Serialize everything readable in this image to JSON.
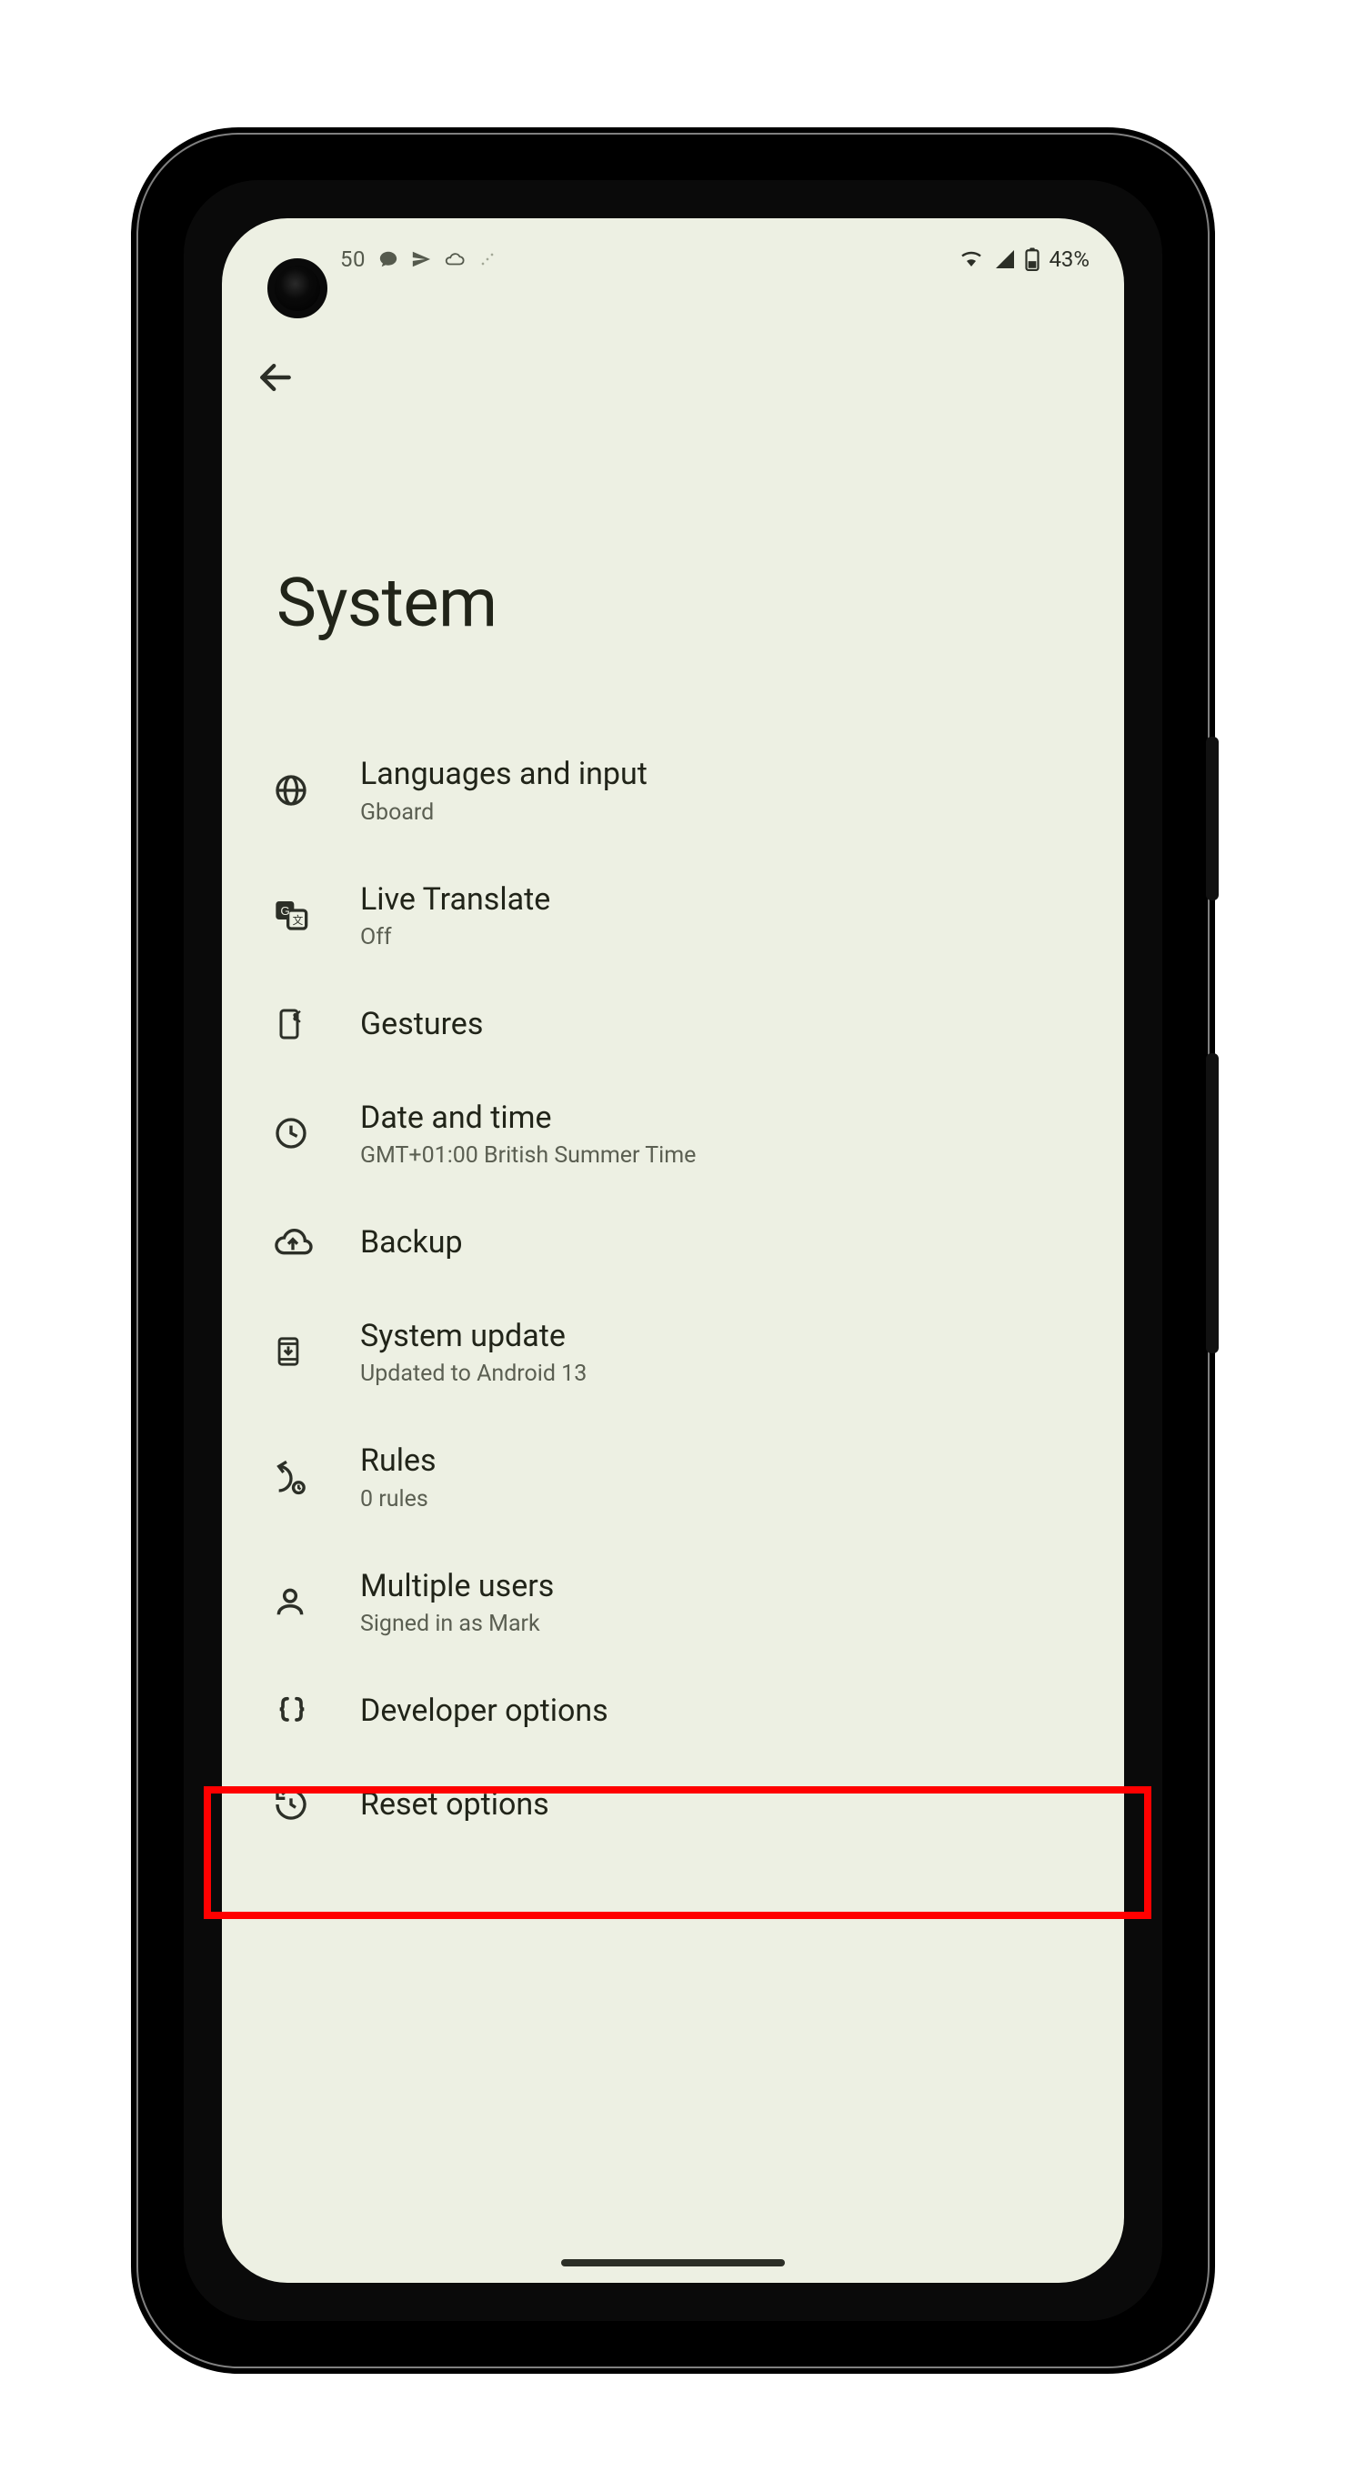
{
  "statusbar": {
    "time": "50",
    "battery_pct": "43%"
  },
  "page": {
    "title": "System"
  },
  "items": [
    {
      "icon": "globe-icon",
      "label": "Languages and input",
      "sub": "Gboard"
    },
    {
      "icon": "translate-icon",
      "label": "Live Translate",
      "sub": "Off"
    },
    {
      "icon": "gesture-icon",
      "label": "Gestures",
      "sub": ""
    },
    {
      "icon": "clock-icon",
      "label": "Date and time",
      "sub": "GMT+01:00 British Summer Time"
    },
    {
      "icon": "backup-icon",
      "label": "Backup",
      "sub": ""
    },
    {
      "icon": "update-icon",
      "label": "System update",
      "sub": "Updated to Android 13"
    },
    {
      "icon": "rules-icon",
      "label": "Rules",
      "sub": "0 rules"
    },
    {
      "icon": "users-icon",
      "label": "Multiple users",
      "sub": "Signed in as Mark"
    },
    {
      "icon": "braces-icon",
      "label": "Developer options",
      "sub": ""
    },
    {
      "icon": "reset-icon",
      "label": "Reset options",
      "sub": ""
    }
  ],
  "highlight_index": 8
}
